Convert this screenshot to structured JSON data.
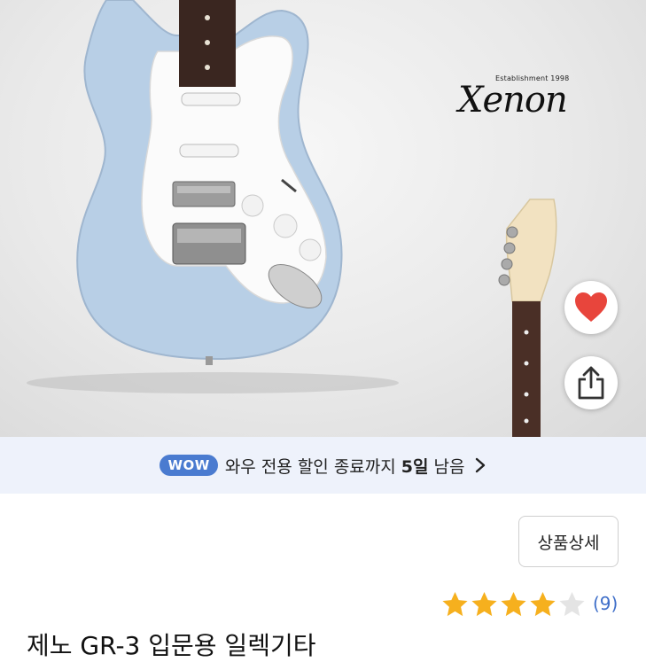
{
  "brand": {
    "established": "Establishment 1998",
    "name": "Xenon"
  },
  "actions": {
    "favorite_icon": "heart-icon",
    "share_icon": "share-icon",
    "favorite_color": "#e8453c"
  },
  "promo_banner": {
    "badge": "WOW",
    "text_before": "와우 전용 할인 종료까지 ",
    "days": "5일",
    "text_after": " 남음",
    "badge_color": "#4a7bd0",
    "background": "#eef2fb"
  },
  "product": {
    "detail_button": "상품상세",
    "rating": 4,
    "rating_max": 5,
    "review_count": "(9)",
    "title": "제노 GR-3 입문용 일렉기타",
    "star_color": "#f6b01e"
  }
}
